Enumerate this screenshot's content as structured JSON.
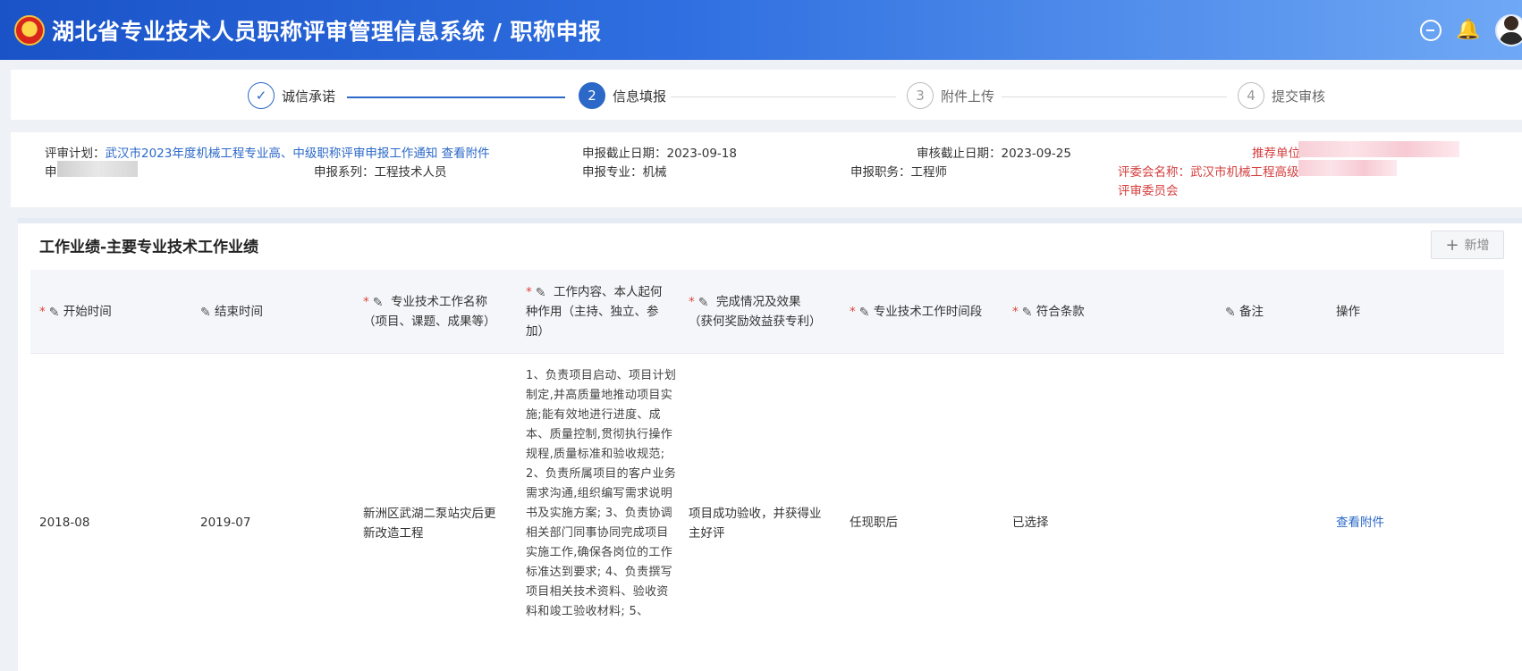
{
  "header": {
    "title": "湖北省专业技术人员职称评审管理信息系统 / 职称申报",
    "emblem_icon": "national-emblem-icon",
    "colors": {
      "header_start": "#1a53c8",
      "header_end": "#6fa8f5",
      "accent": "#2b68c8",
      "required": "#e0443b"
    }
  },
  "steps": [
    {
      "index": "1",
      "label": "诚信承诺",
      "state": "done"
    },
    {
      "index": "2",
      "label": "信息填报",
      "state": "active"
    },
    {
      "index": "3",
      "label": "附件上传",
      "state": "pending"
    },
    {
      "index": "4",
      "label": "提交审核",
      "state": "pending"
    }
  ],
  "info": {
    "plan_label": "评审计划：",
    "plan_link": "武汉市2023年度机械工程专业高、中级职称评审申报工作通知",
    "plan_attach": "查看附件",
    "deadline": "申报截止日期：2023-09-18",
    "review_deadline": "审核截止日期：2023-09-25",
    "recommend_unit": "推荐单位",
    "applicant_prefix": "申",
    "series": "申报系列：工程技术人员",
    "major": "申报专业：机械",
    "position": "申报职务：工程师",
    "committee_label": "评委会名称：武汉市机械工程高级",
    "committee_label_2": "评审委员会"
  },
  "card": {
    "title": "工作业绩-主要专业技术工作业绩",
    "add_label": "新增"
  },
  "table": {
    "columns": [
      {
        "label": "开始时间",
        "required": true,
        "edit": true
      },
      {
        "label": "结束时间",
        "required": false,
        "edit": true
      },
      {
        "label": "专业技术工作名称",
        "label2": "（项目、课题、成果等）",
        "required": true,
        "edit": true
      },
      {
        "label": "工作内容、本人起何",
        "label2": "种作用（主持、独立、参",
        "label3": "加）",
        "required": true,
        "edit": true
      },
      {
        "label": "完成情况及效果",
        "label2": "（获何奖励效益获专利）",
        "required": true,
        "edit": true
      },
      {
        "label": "专业技术工作时间段",
        "required": true,
        "edit": true
      },
      {
        "label": "符合条款",
        "required": true,
        "edit": true
      },
      {
        "label": "备注",
        "required": false,
        "edit": true
      },
      {
        "label": "操作",
        "required": false,
        "edit": false
      }
    ],
    "rows": [
      {
        "start": "2018-08",
        "end": "2019-07",
        "name": "新洲区武湖二泵站灾后更新改造工程",
        "content": "1、负责项目启动、项目计划制定,并高质量地推动项目实施;能有效地进行进度、成本、质量控制,贯彻执行操作规程,质量标准和验收规范; 2、负责所属项目的客户业务需求沟通,组织编写需求说明书及实施方案; 3、负责协调相关部门同事协同完成项目实施工作,确保各岗位的工作标准达到要求; 4、负责撰写项目相关技术资料、验收资料和竣工验收材料; 5、",
        "result": "项目成功验收，并获得业主好评",
        "period": "任现职后",
        "clause": "已选择",
        "remark": "",
        "action": "查看附件"
      }
    ]
  }
}
